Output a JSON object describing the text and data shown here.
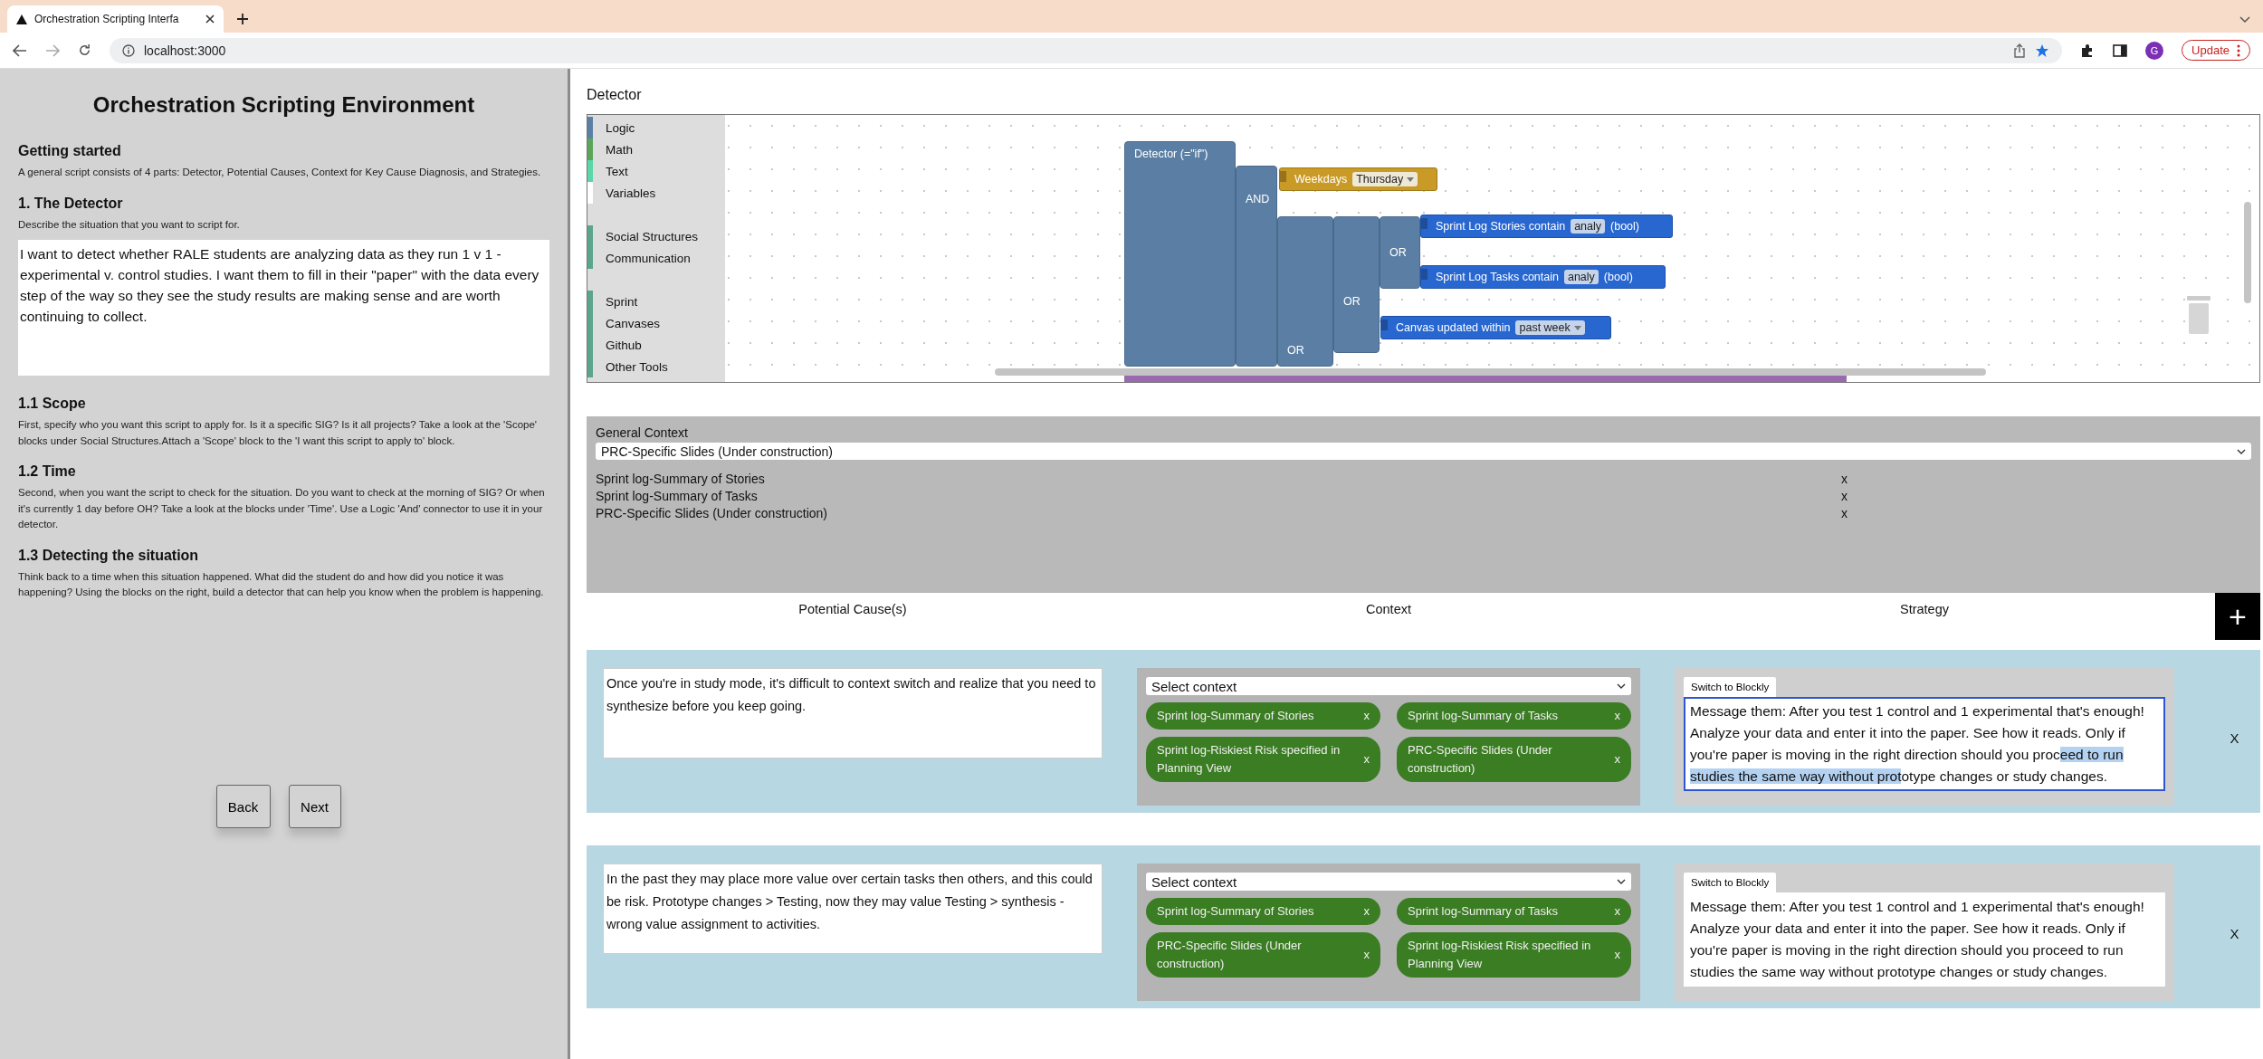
{
  "browser": {
    "tab_title": "Orchestration Scripting Interfa",
    "url": "localhost:3000",
    "avatar": "G",
    "update_label": "Update"
  },
  "left_panel": {
    "title": "Orchestration Scripting Environment",
    "sections": [
      {
        "heading": "Getting started",
        "text": "A general script consists of 4 parts: Detector, Potential Causes, Context for Key Cause Diagnosis, and Strategies."
      },
      {
        "heading": "1. The Detector",
        "text": "Describe the situation that you want to script for.",
        "answer": "I want to detect whether RALE students are analyzing data as they run 1 v 1 - experimental v. control studies. I want them to fill in their \"paper\" with the data every step of the way so they see the study results are making sense and are worth continuing to collect."
      },
      {
        "heading": "1.1 Scope",
        "text": "First, specify who you want this script to apply for. Is it a specific SIG? Is it all projects? Take a look at the 'Scope' blocks under Social Structures.Attach a 'Scope' block to the 'I want this script to apply to' block."
      },
      {
        "heading": "1.2 Time",
        "text": "Second, when you want the script to check for the situation. Do you want to check at the morning of SIG? Or when it's currently 1 day before OH? Take a look at the blocks under 'Time'. Use a Logic 'And' connector to use it in your detector."
      },
      {
        "heading": "1.3 Detecting the situation",
        "text": "Think back to a time when this situation happened. What did the student do and how did you notice it was happening? Using the blocks on the right, build a detector that can help you know when the problem is happening."
      }
    ],
    "buttons": [
      "Back",
      "Next"
    ]
  },
  "detector": {
    "title": "Detector",
    "toolbox": [
      [
        {
          "label": "Logic",
          "color": "#5b80a5"
        },
        {
          "label": "Math",
          "color": "#5ba55b"
        },
        {
          "label": "Text",
          "color": "#5bd6a8"
        },
        {
          "label": "Variables",
          "color": "#ffffff"
        }
      ],
      [
        {
          "label": "Social Structures",
          "color": "#5ba58c"
        },
        {
          "label": "Communication",
          "color": "#5ba58c"
        }
      ],
      [
        {
          "label": "Sprint",
          "color": "#5ba58c"
        },
        {
          "label": "Canvases",
          "color": "#5ba58c"
        },
        {
          "label": "Github",
          "color": "#5ba58c"
        },
        {
          "label": "Other Tools",
          "color": "#5ba58c"
        }
      ]
    ],
    "blocks": [
      {
        "kind": "detector",
        "label": "Detector (=\"if\")"
      },
      {
        "kind": "logic",
        "label": "AND"
      },
      {
        "kind": "time",
        "label": "Weekdays",
        "dropdown": "Thursday"
      },
      {
        "kind": "logic",
        "label": "OR"
      },
      {
        "kind": "logic",
        "label": "OR"
      },
      {
        "kind": "logic",
        "label": "OR"
      },
      {
        "kind": "sprint",
        "label": "Sprint Log Stories contain",
        "field": "analy",
        "suffix": "(bool)"
      },
      {
        "kind": "sprint",
        "label": "Sprint Log Tasks contain",
        "field": "analy",
        "suffix": "(bool)"
      },
      {
        "kind": "sprint",
        "label": "Canvas updated within",
        "dropdown": "past week"
      }
    ]
  },
  "general_context": {
    "title": "General Context",
    "select_value": "PRC-Specific Slides (Under construction)",
    "items": [
      {
        "label": "Sprint log-Summary of Stories",
        "remove": "x"
      },
      {
        "label": "Sprint log-Summary of Tasks",
        "remove": "x"
      },
      {
        "label": "PRC-Specific Slides (Under construction)",
        "remove": "x"
      }
    ]
  },
  "columns": [
    "Potential Cause(s)",
    "Context",
    "Strategy"
  ],
  "add_button": "+",
  "rows": [
    {
      "cause": "Once you're in study mode, it's difficult to context switch and realize that you need to synthesize before you keep going.",
      "context_select": "Select context",
      "chips": [
        {
          "label": "Sprint log-Summary of Stories",
          "remove": "x"
        },
        {
          "label": "Sprint log-Summary of Tasks",
          "remove": "x"
        },
        {
          "label": "Sprint log-Riskiest Risk specified in Planning View",
          "remove": "x"
        },
        {
          "label": "PRC-Specific Slides (Under construction)",
          "remove": "x"
        }
      ],
      "switch_button": "Switch to Blockly",
      "focused": true,
      "strategy": [
        {
          "text": "Message them: After you test 1 control and 1 experimental that's enough! Analyze your data and enter it into the paper. See how it reads. Only if you're paper is moving in the right direction should you proc",
          "selected": false
        },
        {
          "text": "eed to run studies the same way without prot",
          "selected": true
        },
        {
          "text": "otype changes or study changes.",
          "selected": false
        }
      ],
      "remove": "X"
    },
    {
      "cause": "In the past they may place more value over certain tasks then others, and this could be risk. Prototype changes > Testing, now they may value Testing > synthesis - wrong value assignment to activities.",
      "context_select": "Select context",
      "chips": [
        {
          "label": "Sprint log-Summary of Stories",
          "remove": "x"
        },
        {
          "label": "Sprint log-Summary of Tasks",
          "remove": "x"
        },
        {
          "label": "PRC-Specific Slides (Under construction)",
          "remove": "x"
        },
        {
          "label": "Sprint log-Riskiest Risk specified in Planning View",
          "remove": "x"
        }
      ],
      "switch_button": "Switch to Blockly",
      "focused": false,
      "strategy": [
        {
          "text": "Message them: After you test 1 control and 1 experimental that's enough! Analyze your data and enter it into the paper. See how it reads. Only if you're paper is moving in the right direction should you proceed to run studies the same way without prototype changes or study changes.",
          "selected": false
        }
      ],
      "remove": "X"
    }
  ]
}
